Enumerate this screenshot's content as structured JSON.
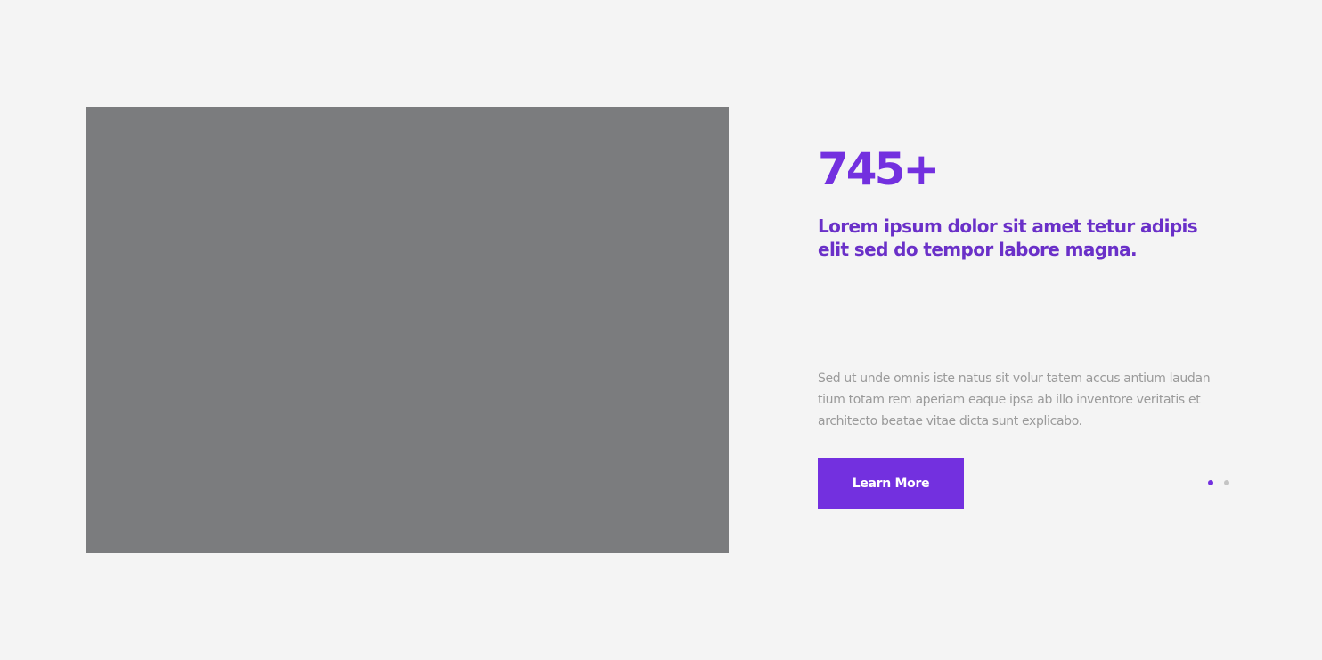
{
  "hero": {
    "stat": "745+",
    "headline": "Lorem ipsum dolor sit amet tetur adipis elit sed do tempor labore magna.",
    "description": "Sed ut unde omnis iste natus sit volur tatem accus antium laudan tium totam rem aperiam eaque ipsa ab illo inventore veritatis et architecto beatae vitae dicta sunt explicabo.",
    "cta_label": "Learn More"
  },
  "carousel": {
    "total_slides": 2,
    "active_slide": 1
  },
  "colors": {
    "accent": "#7330df",
    "headline": "#6a30c8",
    "body_text": "#9a9a9a",
    "image_placeholder": "#7b7c7e",
    "dot_inactive": "#c4c4c4"
  }
}
